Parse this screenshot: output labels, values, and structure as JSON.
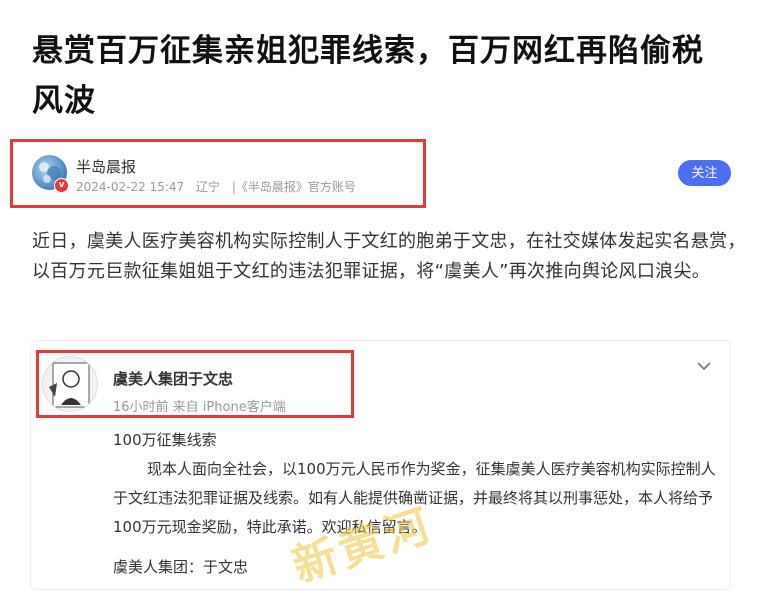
{
  "article": {
    "title": "悬赏百万征集亲姐犯罪线索，百万网红再陷偷税风波",
    "lead": "近日，虞美人医疗美容机构实际控制人于文红的胞弟于文忠，在社交媒体发起实名悬赏，以百万元巨款征集姐姐于文红的违法犯罪证据，将“虞美人”再次推向舆论风口浪尖。"
  },
  "source": {
    "name": "半岛晨报",
    "badge": "v",
    "datetime": "2024-02-22 15:47",
    "location": "辽宁",
    "account": "|《半岛晨报》官方账号",
    "follow_label": "关注",
    "follow_color": "#4e6ef2"
  },
  "weibo": {
    "author": "虞美人集团于文忠",
    "meta": "16小时前 来自 iPhone客户端",
    "heading": "100万征集线索",
    "body": "现本人面向全社会，以100万元人民币作为奖金，征集虞美人医疗美容机构实际控制人于文红违法犯罪证据及线索。如有人能提供确凿证据，并最终将其以刑事惩处，本人将给予100万元现金奖励，特此承诺。欢迎私信留言。",
    "signature": "虞美人集团：于文忠",
    "watermark": "新黄河"
  },
  "icons": {
    "chevron": "chevron-down-icon",
    "verified": "verified-badge-icon"
  },
  "highlight_color": "#e13c3c"
}
